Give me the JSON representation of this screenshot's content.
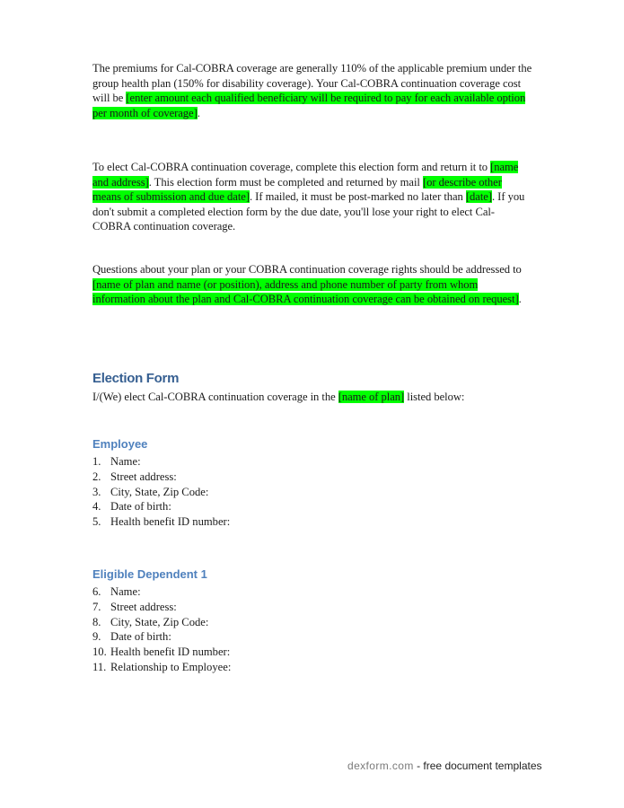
{
  "paragraphs": {
    "premiums": {
      "text_before": "The premiums for Cal-COBRA coverage are generally 110% of the applicable premium under the group health plan (150% for disability coverage). Your Cal-COBRA continuation coverage cost will be ",
      "highlight": "[enter amount each qualified beneficiary will be required to pay for each available option per month of coverage]",
      "text_after": "."
    },
    "elect": {
      "part1": "To elect Cal-COBRA continuation coverage, complete this election form and return it to ",
      "hl1": "[name and address]",
      "part2": ". This election form must be completed and returned by mail ",
      "hl2": "[or describe other means of submission and due date]",
      "part3": ". If mailed, it must be post-marked no later than ",
      "hl3": "[date]",
      "part4": ". If you don't submit a completed election form by the due date, you'll lose your right to elect Cal-COBRA continuation coverage."
    },
    "questions": {
      "text_before": "Questions about your plan or your COBRA continuation coverage rights should be addressed to ",
      "highlight": "[name of plan and name (or position), address and phone number of party from whom information about the plan and Cal-COBRA continuation coverage can be obtained on request]",
      "text_after": "."
    }
  },
  "election_form": {
    "title": "Election Form",
    "intro_before": "I/(We) elect Cal-COBRA continuation coverage in the ",
    "intro_highlight": "[name of plan]",
    "intro_after": " listed below:"
  },
  "employee": {
    "title": "Employee",
    "items": [
      {
        "num": "1.",
        "label": "Name:"
      },
      {
        "num": "2.",
        "label": "Street address:"
      },
      {
        "num": "3.",
        "label": "City, State, Zip Code:"
      },
      {
        "num": "4.",
        "label": "Date of birth:"
      },
      {
        "num": "5.",
        "label": "Health benefit ID number:"
      }
    ]
  },
  "dependent1": {
    "title": "Eligible Dependent 1",
    "items": [
      {
        "num": "6.",
        "label": "Name:"
      },
      {
        "num": "7.",
        "label": "Street address:"
      },
      {
        "num": "8.",
        "label": "City, State, Zip Code:"
      },
      {
        "num": "9.",
        "label": "Date of birth:"
      },
      {
        "num": "10.",
        "label": "Health benefit ID number:"
      },
      {
        "num": "11.",
        "label": "Relationship to Employee:"
      }
    ]
  },
  "footer": {
    "brand": "dexform.com",
    "tagline": " - free document templates"
  },
  "colors": {
    "highlight": "#00ff00",
    "heading_primary": "#365f91",
    "heading_secondary": "#4f81bd",
    "footer_brand": "#7a7a7a"
  }
}
